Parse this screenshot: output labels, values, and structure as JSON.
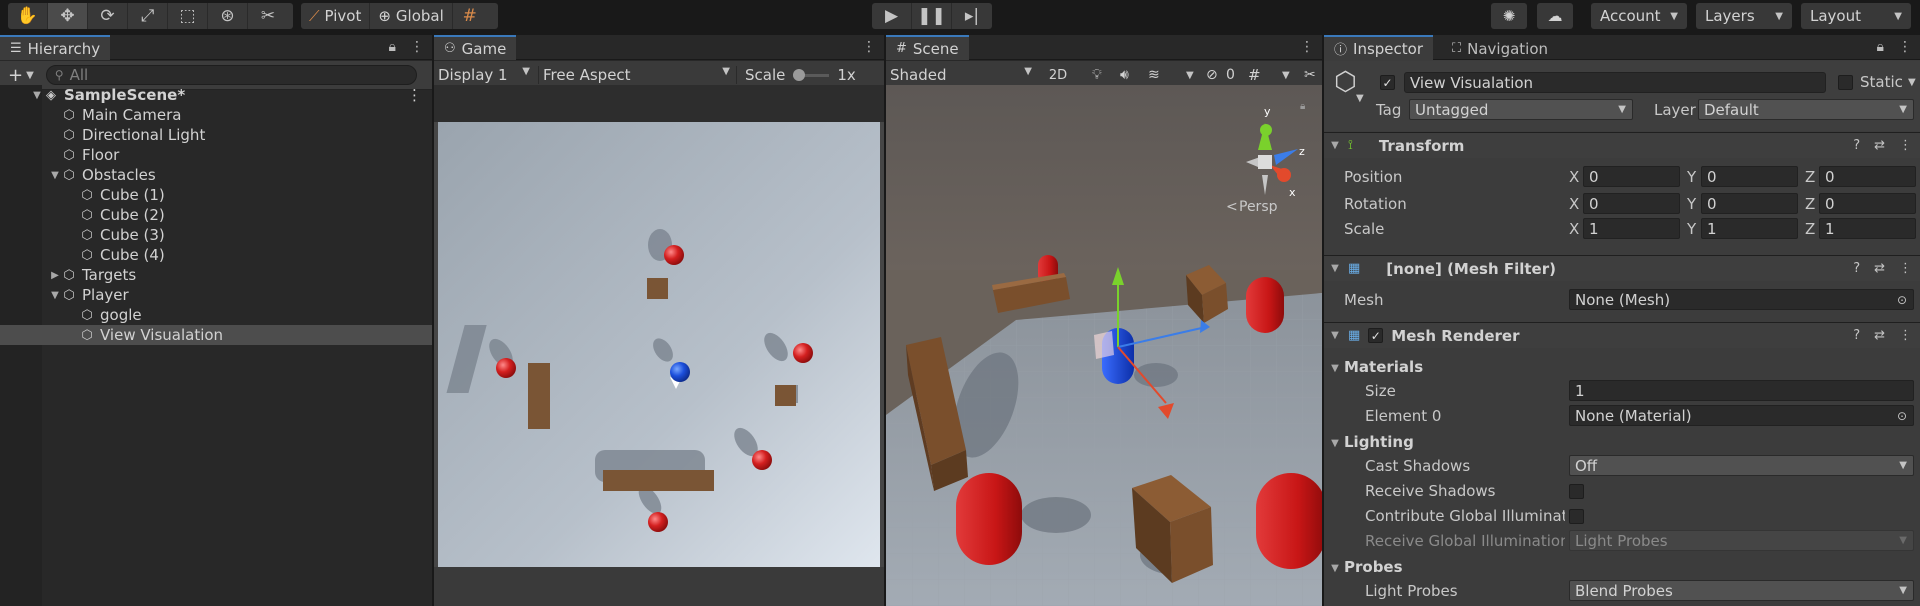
{
  "toolbar": {
    "tools": [
      "hand-tool-icon",
      "move-tool-icon",
      "rotate-tool-icon",
      "scale-tool-icon",
      "rect-tool-icon",
      "transform-tool-icon",
      "custom-tool-icon"
    ],
    "pivot_label": "Pivot",
    "global_label": "Global",
    "account_label": "Account",
    "layers_label": "Layers",
    "layout_label": "Layout"
  },
  "hierarchy": {
    "tab_label": "Hierarchy",
    "search_placeholder": "All",
    "items": [
      {
        "label": "SampleScene*",
        "depth": 0,
        "expanded": true,
        "scene": true
      },
      {
        "label": "Main Camera",
        "depth": 1
      },
      {
        "label": "Directional Light",
        "depth": 1
      },
      {
        "label": "Floor",
        "depth": 1
      },
      {
        "label": "Obstacles",
        "depth": 1,
        "expanded": true
      },
      {
        "label": "Cube (1)",
        "depth": 2
      },
      {
        "label": "Cube (2)",
        "depth": 2
      },
      {
        "label": "Cube (3)",
        "depth": 2
      },
      {
        "label": "Cube (4)",
        "depth": 2
      },
      {
        "label": "Targets",
        "depth": 1,
        "expanded": false
      },
      {
        "label": "Player",
        "depth": 1,
        "expanded": true
      },
      {
        "label": "gogle",
        "depth": 2
      },
      {
        "label": "View Visualation",
        "depth": 2,
        "selected": true
      }
    ]
  },
  "game": {
    "tab_label": "Game",
    "display": "Display 1",
    "aspect": "Free Aspect",
    "scale_label": "Scale",
    "scale_value": "1x"
  },
  "scene": {
    "tab_label": "Scene",
    "shading": "Shaded",
    "mode_2d": "2D",
    "hidden_count": "0",
    "persp_label": "Persp",
    "gizmo_y": "y",
    "gizmo_z": "z",
    "gizmo_x": "x"
  },
  "inspector": {
    "tab_label": "Inspector",
    "nav_tab_label": "Navigation",
    "object_name": "View Visualation",
    "static_label": "Static",
    "tag_label": "Tag",
    "tag_value": "Untagged",
    "layer_label": "Layer",
    "layer_value": "Default",
    "transform": {
      "title": "Transform",
      "position_label": "Position",
      "rotation_label": "Rotation",
      "scale_label": "Scale",
      "axis_x": "X",
      "axis_y": "Y",
      "axis_z": "Z",
      "position": [
        "0",
        "0",
        "0"
      ],
      "rotation": [
        "0",
        "0",
        "0"
      ],
      "scale": [
        "1",
        "1",
        "1"
      ]
    },
    "mesh_filter": {
      "title": "[none] (Mesh Filter)",
      "mesh_label": "Mesh",
      "mesh_value": "None (Mesh)"
    },
    "mesh_renderer": {
      "title": "Mesh Renderer",
      "materials_label": "Materials",
      "size_label": "Size",
      "size_value": "1",
      "element0_label": "Element 0",
      "element0_value": "None (Material)",
      "lighting_label": "Lighting",
      "cast_shadows_label": "Cast Shadows",
      "cast_shadows_value": "Off",
      "receive_shadows_label": "Receive Shadows",
      "contribute_gi_label": "Contribute Global Illumination",
      "receive_gi_label": "Receive Global Illumination",
      "receive_gi_value": "Light Probes",
      "probes_label": "Probes",
      "light_probes_label": "Light Probes",
      "light_probes_value": "Blend Probes"
    }
  }
}
